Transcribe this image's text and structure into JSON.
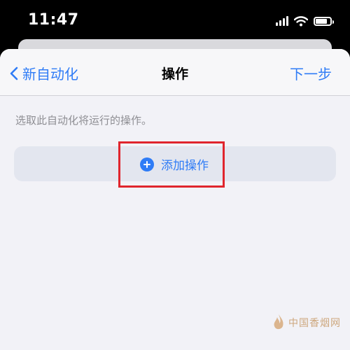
{
  "status_bar": {
    "time": "11:47",
    "battery_level": 0.8
  },
  "nav": {
    "back_label": "新自动化",
    "title": "操作",
    "next_label": "下一步"
  },
  "instruction": "选取此自动化将运行的操作。",
  "add_action": {
    "label": "添加操作"
  },
  "watermark": {
    "text": "中国香烟网"
  },
  "colors": {
    "accent": "#2f7cf6",
    "highlight": "#e0252d",
    "sheet_background": "#f2f2f7",
    "button_background": "#e3e6ef"
  },
  "icons": [
    "signal-icon",
    "wifi-icon",
    "battery-icon",
    "chevron-left-icon",
    "plus-circle-icon",
    "flame-logo-icon"
  ]
}
